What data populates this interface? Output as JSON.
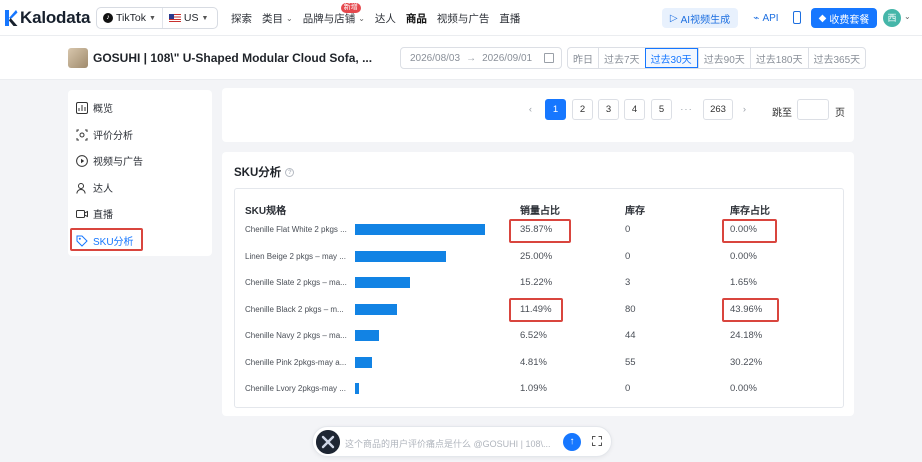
{
  "brand": {
    "name": "Kalodata"
  },
  "platform": {
    "app": "TikTok",
    "region": "US"
  },
  "nav": {
    "items": [
      "探索",
      "类目",
      "品牌与店铺",
      "达人",
      "商品",
      "视频与广告",
      "直播"
    ],
    "new_badge": "新增",
    "active": "商品"
  },
  "header_actions": {
    "ai_video": "AI视频生成",
    "api": "API",
    "vip": "收费套餐",
    "avatar": "西"
  },
  "product": {
    "title": "GOSUHI | 108\\\" U-Shaped Modular Cloud Sofa, ..."
  },
  "date_range": {
    "start": "2026/08/03",
    "arrow": "→",
    "end": "2026/09/01"
  },
  "periods": {
    "items": [
      "昨日",
      "过去7天",
      "过去30天",
      "过去90天",
      "过去180天",
      "过去365天"
    ],
    "selected": "过去30天"
  },
  "sidebar": {
    "items": [
      {
        "label": "概览",
        "icon": "chart-icon"
      },
      {
        "label": "评价分析",
        "icon": "review-icon"
      },
      {
        "label": "视频与广告",
        "icon": "play-icon"
      },
      {
        "label": "达人",
        "icon": "user-icon"
      },
      {
        "label": "直播",
        "icon": "live-icon"
      },
      {
        "label": "SKU分析",
        "icon": "tag-icon"
      }
    ],
    "active": "SKU分析"
  },
  "pagination": {
    "prev": "‹",
    "pages": [
      "1",
      "2",
      "3",
      "4",
      "5"
    ],
    "dots": "···",
    "last": "263",
    "next": "›",
    "current": "1",
    "jump_label": "跳至",
    "page_label": "页"
  },
  "sku": {
    "title": "SKU分析",
    "headers": {
      "spec": "SKU规格",
      "sales_share": "销量占比",
      "stock": "库存",
      "stock_share": "库存占比"
    },
    "rows": [
      {
        "name": "Chenille Flat White 2 pkgs ...",
        "sales_share": "35.87%",
        "share_value": 35.87,
        "stock": "0",
        "stock_share": "0.00%"
      },
      {
        "name": "Linen Beige 2 pkgs – may ...",
        "sales_share": "25.00%",
        "share_value": 25.0,
        "stock": "0",
        "stock_share": "0.00%"
      },
      {
        "name": "Chenille Slate 2 pkgs – ma...",
        "sales_share": "15.22%",
        "share_value": 15.22,
        "stock": "3",
        "stock_share": "1.65%"
      },
      {
        "name": "Chenille Black 2 pkgs – m...",
        "sales_share": "11.49%",
        "share_value": 11.49,
        "stock": "80",
        "stock_share": "43.96%"
      },
      {
        "name": "Chenille Navy 2 pkgs – ma...",
        "sales_share": "6.52%",
        "share_value": 6.52,
        "stock": "44",
        "stock_share": "24.18%"
      },
      {
        "name": "Chenille Pink 2pkgs-may a...",
        "sales_share": "4.81%",
        "share_value": 4.81,
        "stock": "55",
        "stock_share": "30.22%"
      },
      {
        "name": "Chenille Lvory 2pkgs-may ...",
        "sales_share": "1.09%",
        "share_value": 1.09,
        "stock": "0",
        "stock_share": "0.00%"
      }
    ],
    "bar_color": "#1283e4"
  },
  "ai_bar": {
    "placeholder": "这个商品的用户评价痛点是什么 @GOSUHI | 108\\...",
    "send": "↑"
  },
  "colors": {
    "accent": "#1677ff",
    "highlight": "#d9453e"
  }
}
